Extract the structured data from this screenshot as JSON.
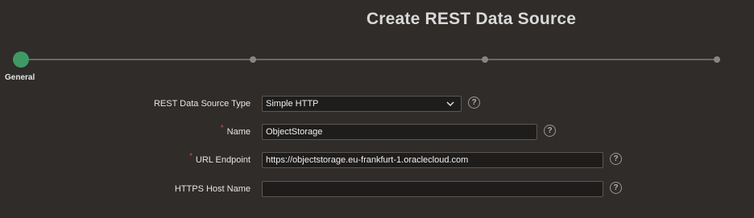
{
  "page": {
    "title": "Create REST Data Source"
  },
  "wizard": {
    "current_step_label": "General",
    "steps": [
      "General",
      "",
      "",
      ""
    ]
  },
  "form": {
    "source_type": {
      "label": "REST Data Source Type",
      "value": "Simple HTTP"
    },
    "name": {
      "label": "Name",
      "required_marker": "*",
      "value": "ObjectStorage"
    },
    "url_endpoint": {
      "label": "URL Endpoint",
      "required_marker": "*",
      "value": "https://objectstorage.eu-frankfurt-1.oraclecloud.com"
    },
    "https_host_name": {
      "label": "HTTPS Host Name",
      "value": ""
    }
  },
  "icons": {
    "help": "?",
    "help_icon_name": "help-circle-icon",
    "chevron": "chevron-down-icon"
  },
  "colors": {
    "background": "#2f2c2a",
    "current_step": "#3e9a64",
    "required": "#e0443e"
  }
}
